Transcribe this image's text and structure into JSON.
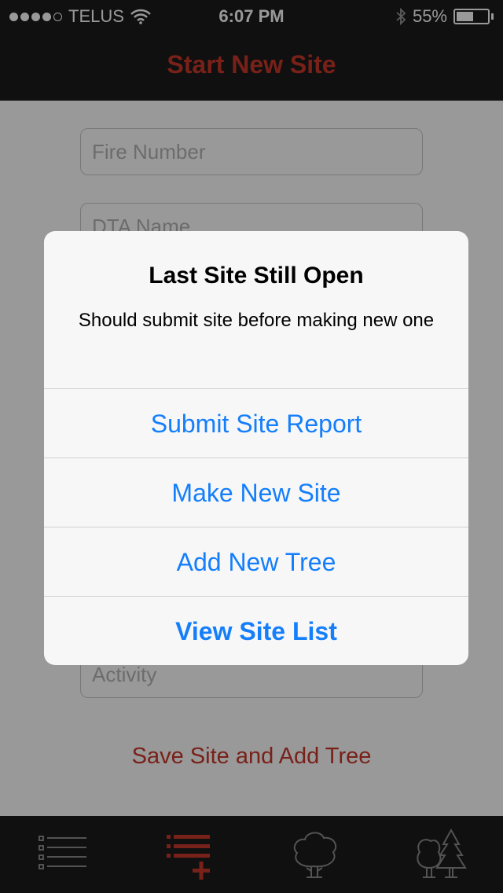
{
  "status_bar": {
    "carrier": "TELUS",
    "time": "6:07 PM",
    "battery": "55%",
    "battery_level": 0.55,
    "signal_icon": "signal-dots-icon",
    "wifi_icon": "wifi-icon",
    "bluetooth_icon": "bluetooth-icon"
  },
  "nav": {
    "title": "Start New Site"
  },
  "form": {
    "fire_number_placeholder": "Fire Number",
    "dta_name_placeholder": "DTA Name",
    "activity_placeholder": "Activity",
    "save_link": "Save Site and Add Tree"
  },
  "alert": {
    "title": "Last Site Still Open",
    "message": "Should submit site before making new one",
    "buttons": [
      {
        "label": "Submit Site Report"
      },
      {
        "label": "Make New Site"
      },
      {
        "label": "Add New Tree"
      },
      {
        "label": "View Site List"
      }
    ]
  },
  "tabbar": {
    "tabs": [
      {
        "icon": "list-icon"
      },
      {
        "icon": "add-list-icon"
      },
      {
        "icon": "tree-icon"
      },
      {
        "icon": "forest-icon"
      }
    ]
  },
  "colors": {
    "accent_red": "#c8382b",
    "ios_blue": "#147efb",
    "bar_background": "#1b1b1b"
  }
}
